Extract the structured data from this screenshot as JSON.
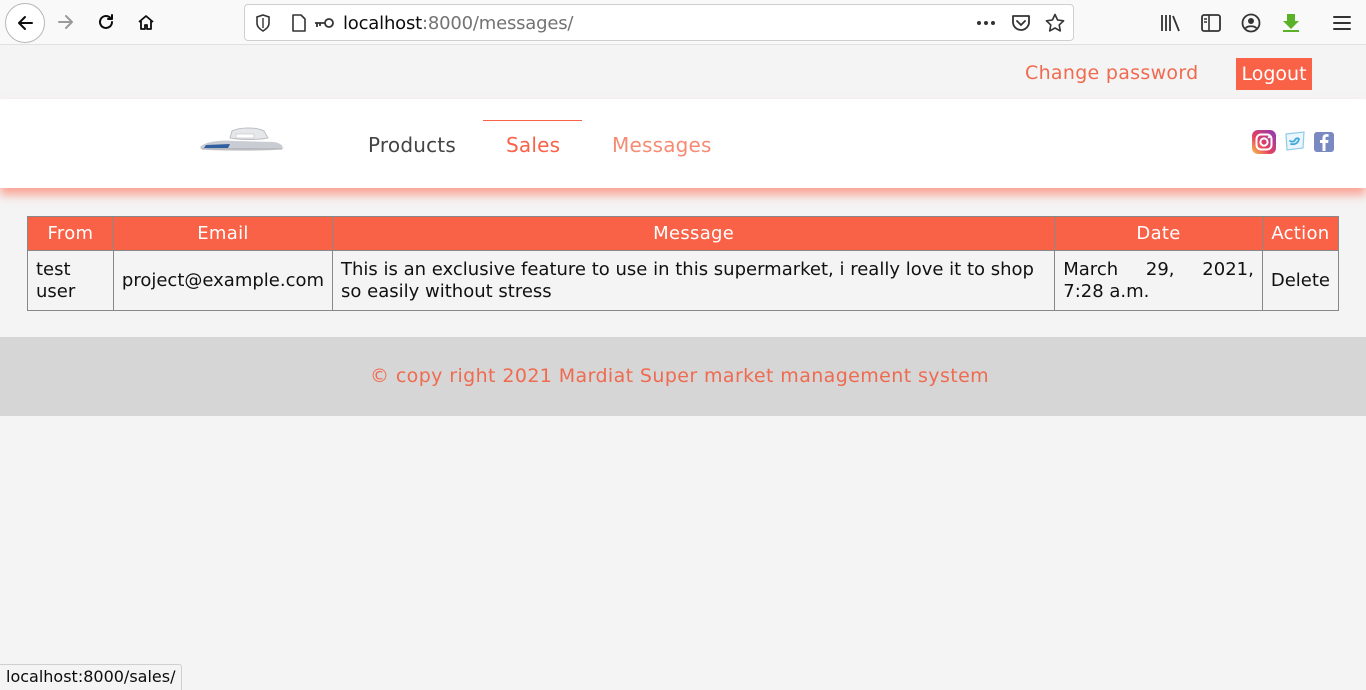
{
  "browser": {
    "url_host": "localhost",
    "url_path": ":8000/messages/",
    "status_url": "localhost:8000/sales/"
  },
  "topbar": {
    "change_password": "Change password",
    "logout": "Logout"
  },
  "nav": {
    "items": [
      {
        "label": "Products"
      },
      {
        "label": "Sales"
      },
      {
        "label": "Messages"
      }
    ]
  },
  "table": {
    "headers": [
      "From",
      "Email",
      "Message",
      "Date",
      "Action"
    ],
    "rows": [
      {
        "from": "test user",
        "email": "project@example.com",
        "message": "This is an exclusive feature to use in this supermarket, i really love it to shop so easily without stress",
        "date": "March 29, 2021, 7:28 a.m.",
        "action": "Delete"
      }
    ]
  },
  "footer": {
    "text": "© copy right 2021 Mardiat Super market management system"
  },
  "colors": {
    "accent": "#f96247",
    "link": "#f06a4f"
  },
  "icons": [
    "back-icon",
    "forward-icon",
    "reload-icon",
    "home-icon",
    "shield-icon",
    "page-icon",
    "key-icon",
    "more-icon",
    "pocket-icon",
    "star-icon",
    "library-icon",
    "sidebar-icon",
    "account-icon",
    "download-icon",
    "menu-icon",
    "instagram-icon",
    "twitter-icon",
    "facebook-icon"
  ]
}
